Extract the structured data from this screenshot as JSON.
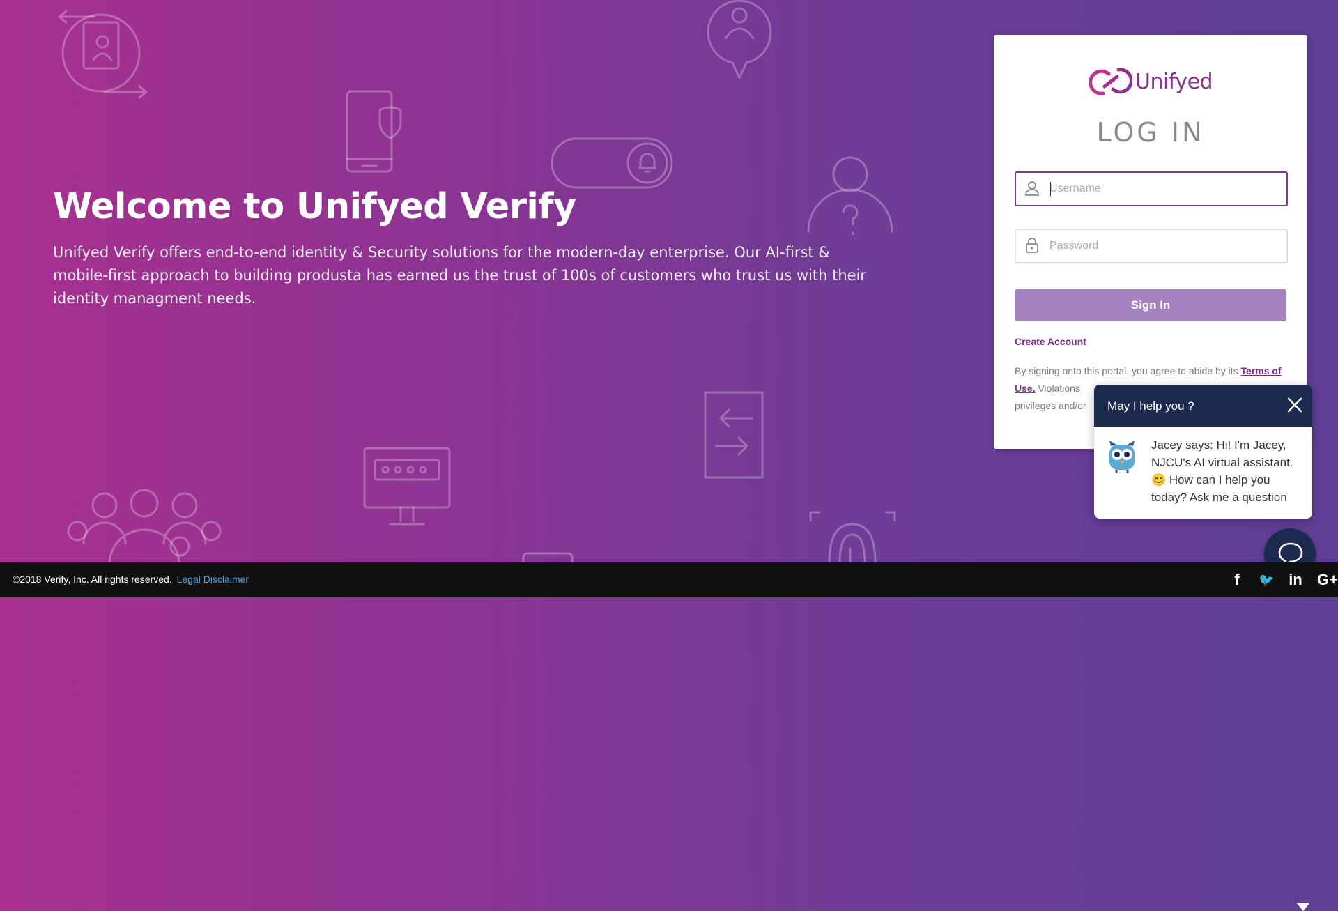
{
  "hero": {
    "title": "Welcome to Unifyed Verify",
    "description": "Unifyed Verify offers end-to-end identity & Security solutions for the modern-day enterprise. Our AI-first & mobile-first approach to building produsta has earned us the trust of 100s of customers who trust us with their identity managment needs."
  },
  "login": {
    "logo_text": "Unifyed",
    "heading": "LOG IN",
    "username_placeholder": "Username",
    "password_placeholder": "Password",
    "sign_in_label": "Sign In",
    "create_account_label": "Create Account",
    "terms_prefix": "By signing onto this portal, you agree to abide by its",
    "terms_link": "Terms of Use.",
    "terms_suffix": "Violations",
    "terms_line3": "privileges and/or"
  },
  "chat": {
    "title": "May I help you ?",
    "message": "Jacey says: Hi! I'm Jacey, NJCU's AI virtual assistant. 😊 How can I help you today? Ask me a question"
  },
  "footer": {
    "copyright": "©2018 Verify, Inc. All rights reserved.",
    "disclaimer_label": "Legal Disclaimer",
    "social": [
      {
        "name": "facebook-icon",
        "glyph": "f"
      },
      {
        "name": "twitter-icon",
        "glyph": "🐦"
      },
      {
        "name": "linkedin-icon",
        "glyph": "in"
      },
      {
        "name": "google-plus-icon",
        "glyph": "G+"
      }
    ]
  },
  "colors": {
    "gradient_start": "#a8308f",
    "gradient_end": "#5f3f96",
    "brand_purple": "#7d2c8f",
    "sign_in_button": "#a483bf",
    "chat_header": "#1b2a4e",
    "footer": "#111111",
    "disclaimer_link": "#4ba3e6"
  }
}
